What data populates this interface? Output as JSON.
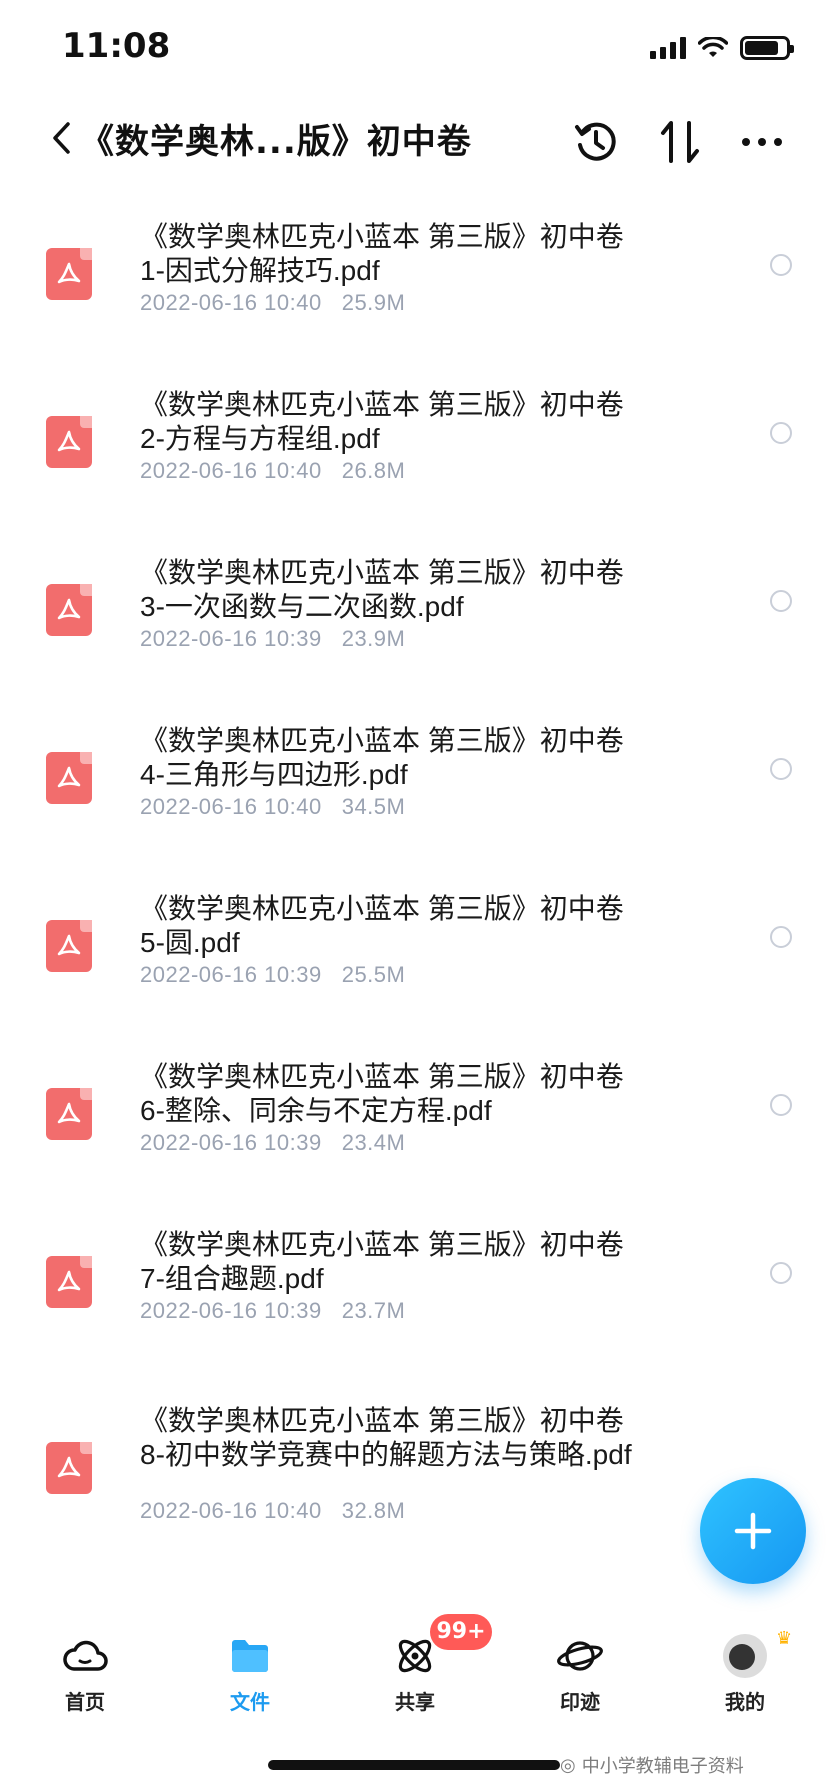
{
  "status_bar": {
    "time": "11:08"
  },
  "header": {
    "title": "《数学奥林...版》初中卷"
  },
  "files": [
    {
      "name_line1": "《数学奥林匹克小蓝本 第三版》初中卷",
      "name_line2": "1-因式分解技巧.pdf",
      "date": "2022-06-16 10:40",
      "size": "25.9M"
    },
    {
      "name_line1": "《数学奥林匹克小蓝本 第三版》初中卷",
      "name_line2": "2-方程与方程组.pdf",
      "date": "2022-06-16 10:40",
      "size": "26.8M"
    },
    {
      "name_line1": "《数学奥林匹克小蓝本 第三版》初中卷",
      "name_line2": "3-一次函数与二次函数.pdf",
      "date": "2022-06-16 10:39",
      "size": "23.9M"
    },
    {
      "name_line1": "《数学奥林匹克小蓝本 第三版》初中卷",
      "name_line2": "4-三角形与四边形.pdf",
      "date": "2022-06-16 10:40",
      "size": "34.5M"
    },
    {
      "name_line1": "《数学奥林匹克小蓝本 第三版》初中卷",
      "name_line2": "5-圆.pdf",
      "date": "2022-06-16 10:39",
      "size": "25.5M"
    },
    {
      "name_line1": "《数学奥林匹克小蓝本 第三版》初中卷",
      "name_line2": "6-整除、同余与不定方程.pdf",
      "date": "2022-06-16 10:39",
      "size": "23.4M"
    },
    {
      "name_line1": "《数学奥林匹克小蓝本 第三版》初中卷",
      "name_line2": "7-组合趣题.pdf",
      "date": "2022-06-16 10:39",
      "size": "23.7M"
    },
    {
      "name_line1": "《数学奥林匹克小蓝本 第三版》初中卷",
      "name_line2": "8-初中数学竞赛中的解题方法与策略.pdf",
      "date": "2022-06-16 10:40",
      "size": "32.8M"
    }
  ],
  "tabs": [
    {
      "label": "首页",
      "icon": "cloud-icon"
    },
    {
      "label": "文件",
      "icon": "folder-icon"
    },
    {
      "label": "共享",
      "icon": "share-planet-icon",
      "badge": "99+"
    },
    {
      "label": "印迹",
      "icon": "planet-icon"
    },
    {
      "label": "我的",
      "icon": "avatar"
    }
  ],
  "watermark": "中小学教辅电子资料",
  "colors": {
    "accent": "#1d9bf0",
    "pdf": "#f26d6d",
    "badge": "#ff5a57"
  }
}
